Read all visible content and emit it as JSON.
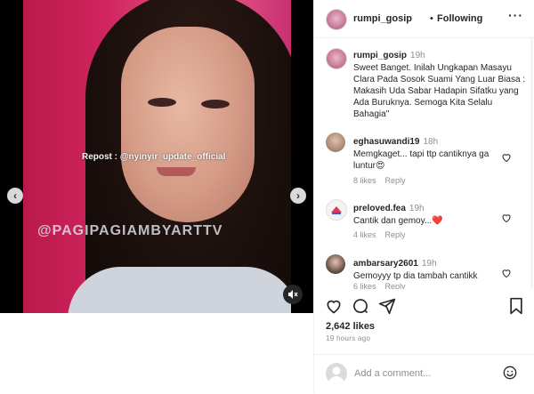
{
  "media": {
    "repost_text": "Repost : @nyinyir_update_official",
    "watermark_text": "@PAGIPAGIAMBYARTTV",
    "prev_icon": "chevron-left-icon",
    "next_icon": "chevron-right-icon",
    "sound_icon": "speaker-muted-icon"
  },
  "header": {
    "username": "rumpi_gosip",
    "separator": "•",
    "follow_status": "Following",
    "more_icon": "more-horizontal-icon"
  },
  "caption": {
    "username": "rumpi_gosip",
    "time": "19h",
    "text": "Sweet Banget. Inilah Ungkapan Masayu Clara Pada Sosok Suami Yang Luar Biasa : Makasih Uda Sabar Hadapin Sifatku yang Ada Buruknya. Semoga Kita Selalu Bahagia\""
  },
  "comments": [
    {
      "username": "eghasuwandi19",
      "time": "18h",
      "text": "Memgkaget... tapi ttp cantiknya ga luntur😍",
      "likes": "8 likes",
      "reply": "Reply"
    },
    {
      "username": "preloved.fea",
      "time": "19h",
      "text": "Cantik dan gemoy...❤️",
      "likes": "4 likes",
      "reply": "Reply"
    },
    {
      "username": "ambarsary2601",
      "time": "19h",
      "text": "Gemoyyy tp dia tambah cantikk",
      "likes": "6 likes",
      "reply": "Reply"
    }
  ],
  "actions": {
    "like_icon": "heart-icon",
    "comment_icon": "comment-icon",
    "share_icon": "share-icon",
    "save_icon": "bookmark-icon"
  },
  "stats": {
    "likes": "2,642 likes",
    "posted": "19 hours ago"
  },
  "add_comment": {
    "placeholder": "Add a comment...",
    "emoji_icon": "smiley-icon"
  },
  "colors": {
    "text": "#262626",
    "muted": "#8e8e8e",
    "border": "#efefef",
    "background_pink": "#d0245e"
  }
}
